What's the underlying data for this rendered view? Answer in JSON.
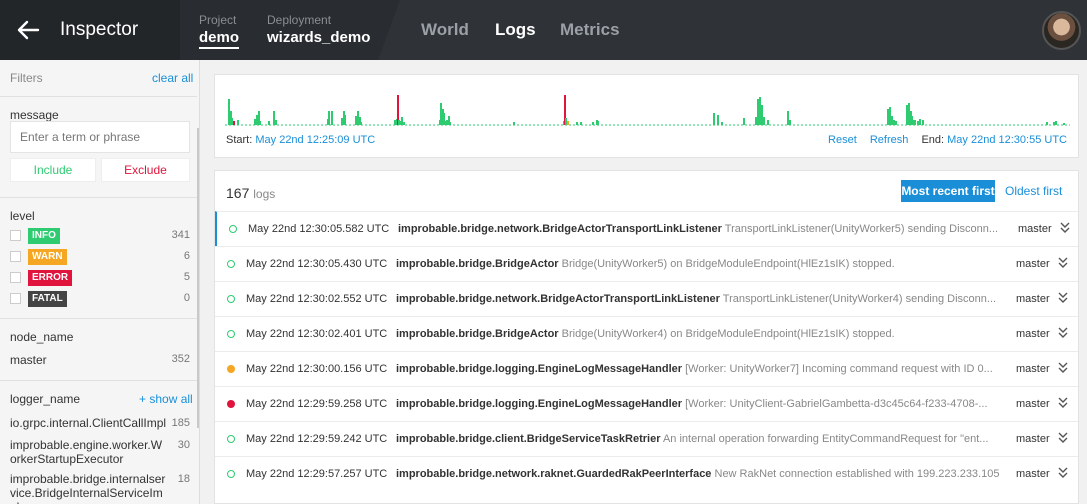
{
  "header": {
    "title": "Inspector",
    "project_label": "Project",
    "project_value": "demo",
    "deployment_label": "Deployment",
    "deployment_value": "wizards_demo",
    "nav": [
      "World",
      "Logs",
      "Metrics"
    ],
    "active_nav": "Logs"
  },
  "sidebar": {
    "filters_label": "Filters",
    "clear_all": "clear all",
    "message_title": "message",
    "message_placeholder": "Enter a term or phrase",
    "include_label": "Include",
    "exclude_label": "Exclude",
    "level_title": "level",
    "levels": [
      {
        "label": "INFO",
        "count": "341",
        "color": "#2ecb71"
      },
      {
        "label": "WARN",
        "count": "6",
        "color": "#f5a623"
      },
      {
        "label": "ERROR",
        "count": "5",
        "color": "#e0143c"
      },
      {
        "label": "FATAL",
        "count": "0",
        "color": "#444444"
      }
    ],
    "node_title": "node_name",
    "nodes": [
      {
        "name": "master",
        "count": "352"
      }
    ],
    "logger_title": "logger_name",
    "show_all": "+ show all",
    "loggers": [
      {
        "name": "io.grpc.internal.ClientCallImpl",
        "count": "185"
      },
      {
        "name": "improbable.engine.worker.WorkerStartupExecutor",
        "count": "30"
      },
      {
        "name": "improbable.bridge.internalservice.BridgeInternalServiceImpl",
        "count": "18"
      }
    ]
  },
  "histogram": {
    "start_label": "Start:",
    "start_value": "May 22nd 12:25:09 UTC",
    "reset": "Reset",
    "refresh": "Refresh",
    "end_label": "End:",
    "end_value": "May 22nd 12:30:55 UTC"
  },
  "logs": {
    "count": "167",
    "count_unit": "logs",
    "sort_active": "Most recent first",
    "sort_other": "Oldest first",
    "rows": [
      {
        "level": "info",
        "time": "May 22nd 12:30:05.582 UTC",
        "logger": "improbable.bridge.network.BridgeActorTransportLinkListener",
        "message": "TransportLinkListener(UnityWorker5) sending Disconn...",
        "worker": "master"
      },
      {
        "level": "info",
        "time": "May 22nd 12:30:05.430 UTC",
        "logger": "improbable.bridge.BridgeActor",
        "message": "Bridge(UnityWorker5) on BridgeModuleEndpoint(HlEz1sIK) stopped.",
        "worker": "master"
      },
      {
        "level": "info",
        "time": "May 22nd 12:30:02.552 UTC",
        "logger": "improbable.bridge.network.BridgeActorTransportLinkListener",
        "message": "TransportLinkListener(UnityWorker4) sending Disconn...",
        "worker": "master"
      },
      {
        "level": "info",
        "time": "May 22nd 12:30:02.401 UTC",
        "logger": "improbable.bridge.BridgeActor",
        "message": "Bridge(UnityWorker4) on BridgeModuleEndpoint(HlEz1sIK) stopped.",
        "worker": "master"
      },
      {
        "level": "warn",
        "time": "May 22nd 12:30:00.156 UTC",
        "logger": "improbable.bridge.logging.EngineLogMessageHandler",
        "message": "[Worker: UnityWorker7] Incoming command request with ID 0...",
        "worker": "master"
      },
      {
        "level": "error",
        "time": "May 22nd 12:29:59.258 UTC",
        "logger": "improbable.bridge.logging.EngineLogMessageHandler",
        "message": "[Worker: UnityClient-GabrielGambetta-d3c45c64-f233-4708-...",
        "worker": "master"
      },
      {
        "level": "info",
        "time": "May 22nd 12:29:59.242 UTC",
        "logger": "improbable.bridge.client.BridgeServiceTaskRetrier",
        "message": "An internal operation forwarding EntityCommandRequest for \"ent...",
        "worker": "master"
      },
      {
        "level": "info",
        "time": "May 22nd 12:29:57.257 UTC",
        "logger": "improbable.bridge.network.raknet.GuardedRakPeerInterface",
        "message": "New RakNet connection established with 199.223.233.105",
        "worker": "master"
      }
    ]
  }
}
